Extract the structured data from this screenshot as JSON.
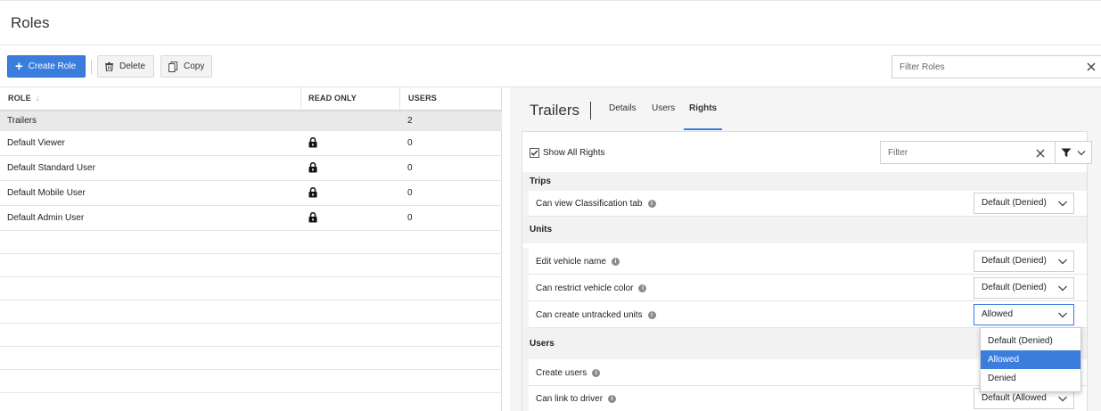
{
  "page": {
    "title": "Roles"
  },
  "toolbar": {
    "create_label": "Create Role",
    "delete_label": "Delete",
    "copy_label": "Copy",
    "filter_placeholder": "Filter Roles"
  },
  "table": {
    "columns": {
      "role": "ROLE",
      "read_only": "READ ONLY",
      "users": "USERS"
    },
    "rows": [
      {
        "role": "Trailers",
        "read_only": false,
        "users": "2"
      },
      {
        "role": "Default Viewer",
        "read_only": true,
        "users": "0"
      },
      {
        "role": "Default Standard User",
        "read_only": true,
        "users": "0"
      },
      {
        "role": "Default Mobile User",
        "read_only": true,
        "users": "0"
      },
      {
        "role": "Default Admin User",
        "read_only": true,
        "users": "0"
      }
    ]
  },
  "detail": {
    "title": "Trailers",
    "tabs": {
      "details": "Details",
      "users": "Users",
      "rights": "Rights"
    },
    "show_all_label": "Show All Rights",
    "filter_placeholder": "Filter",
    "sections": {
      "trips": "Trips",
      "units": "Units",
      "users": "Users"
    },
    "rights": {
      "classification": {
        "label": "Can view Classification tab",
        "value": "Default (Denied)"
      },
      "edit_vehicle": {
        "label": "Edit vehicle name",
        "value": "Default (Denied)"
      },
      "restrict_color": {
        "label": "Can restrict vehicle color",
        "value": "Default (Denied)"
      },
      "untracked_units": {
        "label": "Can create untracked units",
        "value": "Allowed"
      },
      "create_users": {
        "label": "Create users",
        "value": ""
      },
      "link_driver": {
        "label": "Can link to driver",
        "value": "Default (Allowed"
      }
    },
    "dropdown_options": [
      "Default (Denied)",
      "Allowed",
      "Denied"
    ]
  },
  "colors": {
    "accent": "#3b7ddd",
    "selected_row": "#e9e9e9"
  }
}
